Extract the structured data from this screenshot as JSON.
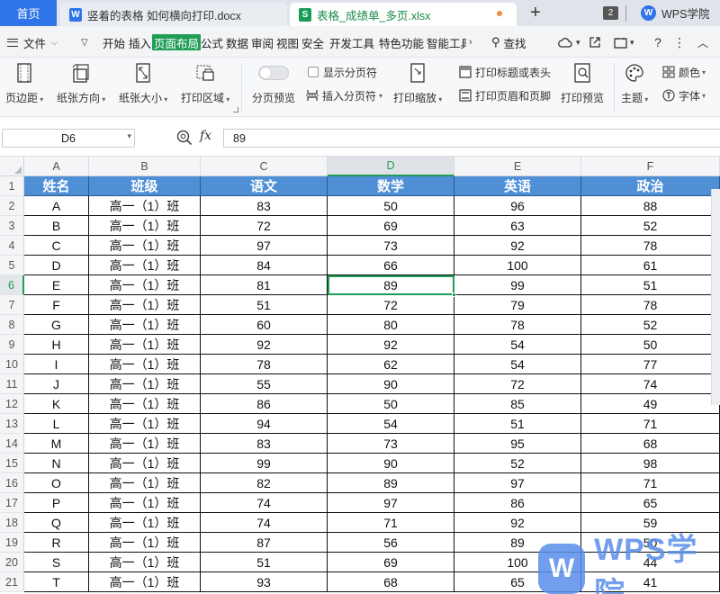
{
  "tabs": {
    "home": "首页",
    "doc": "竖着的表格 如何横向打印.docx",
    "xls": "表格_成绩单_多页.xlsx",
    "plus": "+",
    "count": "2",
    "academy": "WPS学院"
  },
  "menu": {
    "file": "文件",
    "items": [
      "开始",
      "插入",
      "页面布局",
      "公式",
      "数据",
      "审阅",
      "视图",
      "安全",
      "开发工具",
      "特色功能",
      "智能工具"
    ],
    "search": "查找"
  },
  "ribbon": {
    "margins": "页边距",
    "orientation": "纸张方向",
    "size": "纸张大小",
    "print_area": "打印区域",
    "page_break_preview": "分页预览",
    "show_page_break": "显示分页符",
    "insert_page_break": "插入分页符",
    "print_scale": "打印缩放",
    "print_titles": "打印标题或表头",
    "header_footer": "打印页眉和页脚",
    "print_preview": "打印预览",
    "theme": "主题",
    "colors": "颜色",
    "fonts": "字体"
  },
  "formula": {
    "namebox": "D6",
    "fx": "fx",
    "value": "89"
  },
  "sheet": {
    "columns": [
      "A",
      "B",
      "C",
      "D",
      "E",
      "F"
    ],
    "header_row": [
      "姓名",
      "班级",
      "语文",
      "数学",
      "英语",
      "政治"
    ],
    "rows": [
      [
        "A",
        "高一（1）班",
        "83",
        "50",
        "96",
        "88"
      ],
      [
        "B",
        "高一（1）班",
        "72",
        "69",
        "63",
        "52"
      ],
      [
        "C",
        "高一（1）班",
        "97",
        "73",
        "92",
        "78"
      ],
      [
        "D",
        "高一（1）班",
        "84",
        "66",
        "100",
        "61"
      ],
      [
        "E",
        "高一（1）班",
        "81",
        "89",
        "99",
        "51"
      ],
      [
        "F",
        "高一（1）班",
        "51",
        "72",
        "79",
        "78"
      ],
      [
        "G",
        "高一（1）班",
        "60",
        "80",
        "78",
        "52"
      ],
      [
        "H",
        "高一（1）班",
        "92",
        "92",
        "54",
        "50"
      ],
      [
        "I",
        "高一（1）班",
        "78",
        "62",
        "54",
        "77"
      ],
      [
        "J",
        "高一（1）班",
        "55",
        "90",
        "72",
        "74"
      ],
      [
        "K",
        "高一（1）班",
        "86",
        "50",
        "85",
        "49"
      ],
      [
        "L",
        "高一（1）班",
        "94",
        "54",
        "51",
        "71"
      ],
      [
        "M",
        "高一（1）班",
        "83",
        "73",
        "95",
        "68"
      ],
      [
        "N",
        "高一（1）班",
        "99",
        "90",
        "52",
        "98"
      ],
      [
        "O",
        "高一（1）班",
        "82",
        "89",
        "97",
        "71"
      ],
      [
        "P",
        "高一（1）班",
        "74",
        "97",
        "86",
        "65"
      ],
      [
        "Q",
        "高一（1）班",
        "74",
        "71",
        "92",
        "59"
      ],
      [
        "R",
        "高一（1）班",
        "87",
        "56",
        "89",
        "50"
      ],
      [
        "S",
        "高一（1）班",
        "51",
        "69",
        "100",
        "44"
      ],
      [
        "T",
        "高一（1）班",
        "93",
        "68",
        "65",
        "41"
      ]
    ],
    "row_numbers": [
      "1",
      "2",
      "3",
      "4",
      "5",
      "6",
      "7",
      "8",
      "9",
      "10",
      "11",
      "12",
      "13",
      "14",
      "15",
      "16",
      "17",
      "18",
      "19",
      "20",
      "21"
    ]
  },
  "watermark": {
    "logo": "W",
    "text": "WPS学院"
  },
  "colors": {
    "accent": "#1f9d55",
    "header_fill": "#4f8fd6",
    "home_tab": "#2f74e8"
  }
}
